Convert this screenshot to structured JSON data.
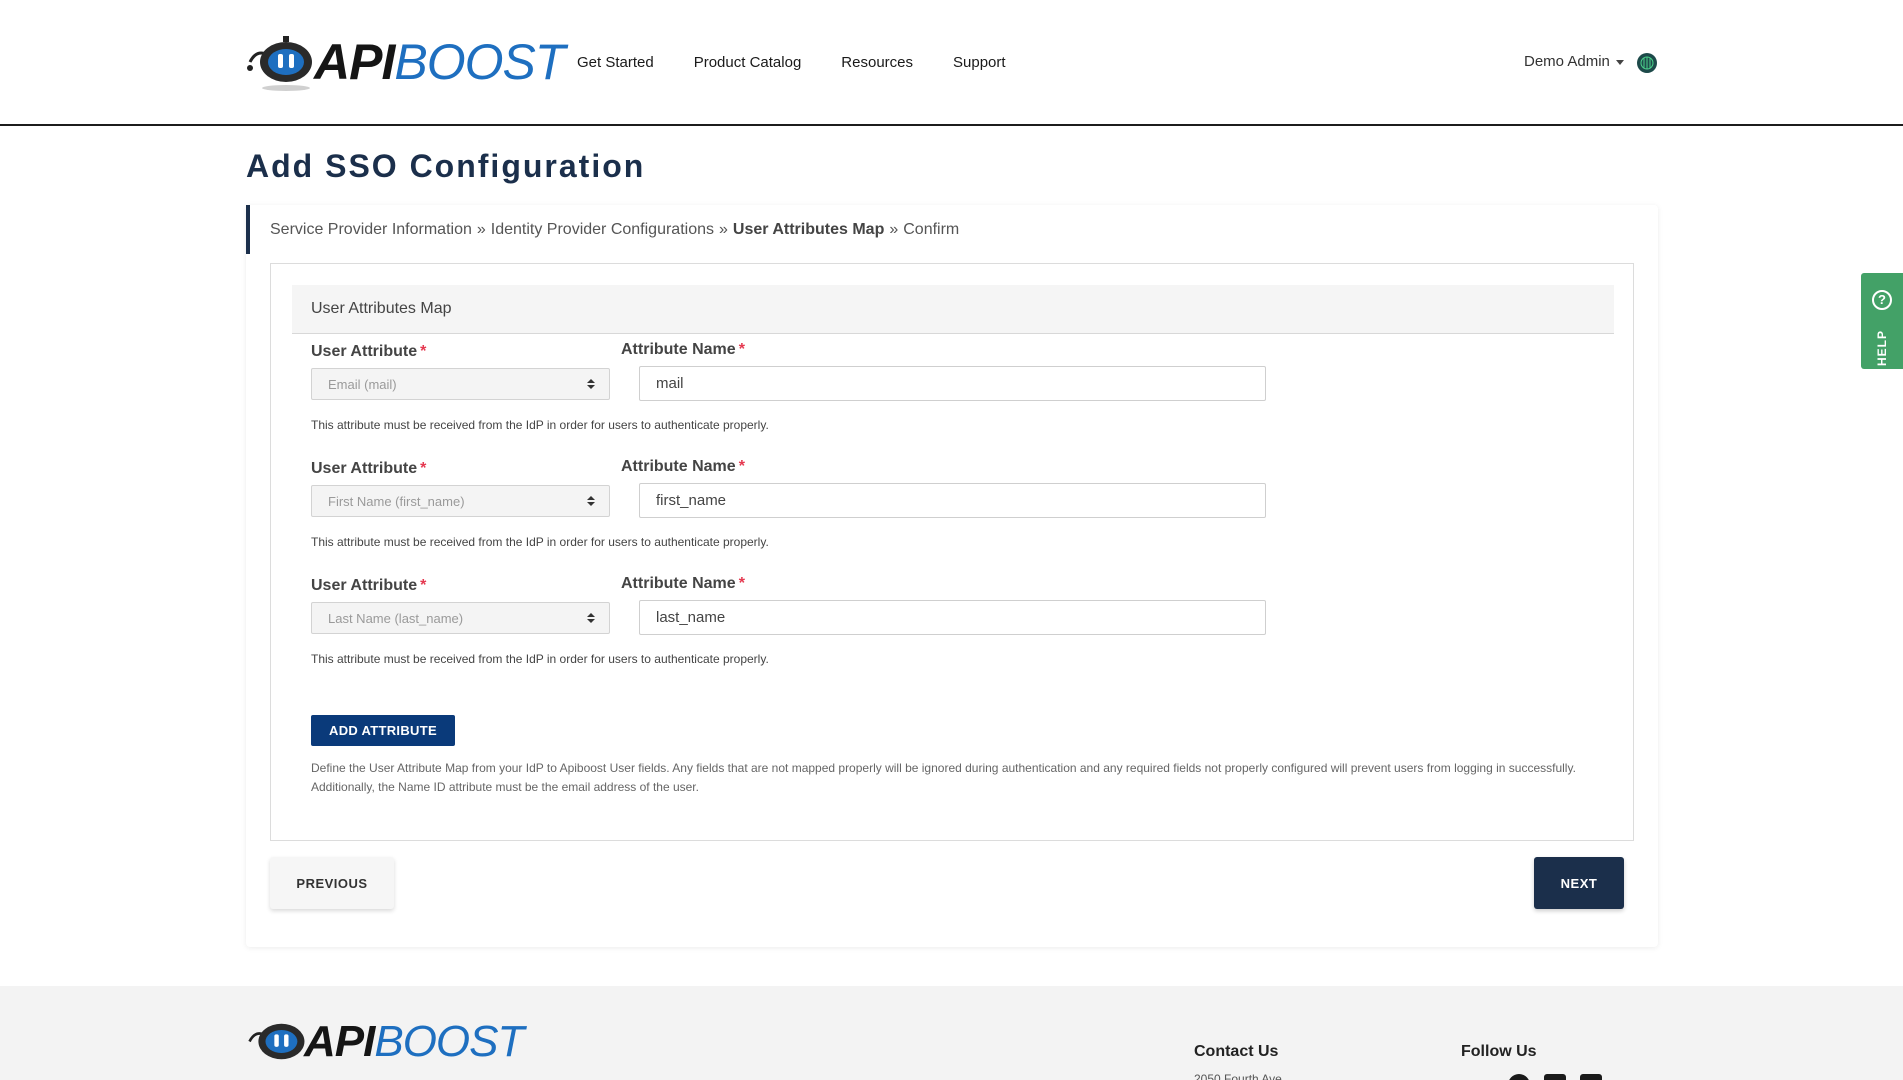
{
  "header": {
    "logo": {
      "api": "API",
      "boost": "BOOST"
    },
    "nav": [
      "Get Started",
      "Product Catalog",
      "Resources",
      "Support"
    ],
    "user_name": "Demo Admin"
  },
  "page": {
    "title": "Add SSO Configuration"
  },
  "breadcrumb": {
    "steps": [
      "Service Provider Information",
      "Identity Provider Configurations",
      "User Attributes Map",
      "Confirm"
    ],
    "separator": "»",
    "active_index": 2
  },
  "panel": {
    "title": "User Attributes Map"
  },
  "attributes": {
    "user_attribute_label": "User Attribute",
    "attribute_name_label": "Attribute Name",
    "required_mark": "*",
    "hint": "This attribute must be received from the IdP in order for users to authenticate properly.",
    "rows": [
      {
        "selected": "Email (mail)",
        "value": "mail"
      },
      {
        "selected": "First Name (first_name)",
        "value": "first_name"
      },
      {
        "selected": "Last Name (last_name)",
        "value": "last_name"
      }
    ]
  },
  "add_button": "ADD ATTRIBUTE",
  "define_text": "Define the User Attribute Map from your IdP to Apiboost User fields. Any fields that are not mapped properly will be ignored during authentication and any required fields not properly configured will prevent users from logging in successfully. Additionally, the Name ID attribute must be the email address of the user.",
  "actions": {
    "previous": "PREVIOUS",
    "next": "NEXT"
  },
  "help": {
    "label": "HELP",
    "icon": "?"
  },
  "footer": {
    "contact_title": "Contact Us",
    "address_partial": "2050 Fourth Ave",
    "follow_title": "Follow Us"
  },
  "colors": {
    "primary_dark": "#1b2f4b",
    "button_blue": "#0a3a7a",
    "help_green": "#43a167",
    "required_red": "#e53950",
    "logo_blue": "#1e6fc0"
  }
}
